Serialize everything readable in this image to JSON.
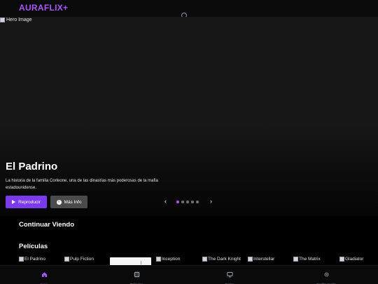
{
  "header": {
    "brand": "AURAFLIX+"
  },
  "hero": {
    "image_alt": "Hero Image",
    "title": "El Padrino",
    "description": "La historia de la familia Corleone, una de las dinastías más poderosas de la mafia estadounidense.",
    "play_label": "Reproducir",
    "info_label": "Más Info",
    "prev_glyph": "‹",
    "next_glyph": "›",
    "slide_count": 5,
    "active_slide": 1
  },
  "sections": {
    "continue_watching": "Continuar Viendo",
    "movies": "Películas"
  },
  "movies": [
    {
      "alt": "El Padrino"
    },
    {
      "alt": "Pulp Fiction"
    },
    {
      "alt": ""
    },
    {
      "alt": "Inception"
    },
    {
      "alt": "The Dark Knight"
    },
    {
      "alt": "Interstellar"
    },
    {
      "alt": "The Matrix"
    },
    {
      "alt": "Gladiator"
    }
  ],
  "nav": {
    "items": [
      {
        "label": "Inicio",
        "icon": "home-icon",
        "active": true
      },
      {
        "label": "Películas",
        "icon": "film-icon",
        "active": false
      },
      {
        "label": "Series",
        "icon": "tv-icon",
        "active": false
      },
      {
        "label": "Configuración",
        "icon": "gear-icon",
        "active": false
      }
    ]
  },
  "colors": {
    "accent": "#a855f7",
    "primary_button": "#7c3aed",
    "secondary_button": "#4b4b4b"
  }
}
